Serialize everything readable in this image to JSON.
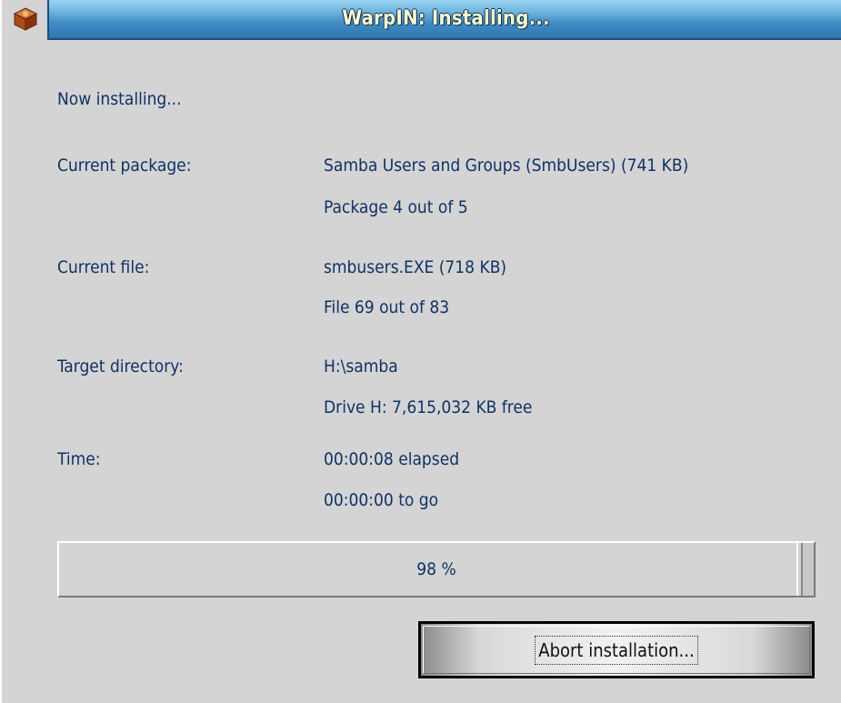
{
  "window": {
    "title": "WarpIN: Installing...",
    "icon": "package-box-icon"
  },
  "status": {
    "heading": "Now installing..."
  },
  "rows": {
    "package": {
      "label": "Current package:",
      "value": "Samba Users and Groups (SmbUsers) (741 KB)",
      "detail": "Package 4 out of 5"
    },
    "file": {
      "label": "Current file:",
      "value": "smbusers.EXE (718 KB)",
      "detail": "File 69 out of 83"
    },
    "target": {
      "label": "Target directory:",
      "value": "H:\\samba",
      "detail": "Drive H: 7,615,032 KB free"
    },
    "time": {
      "label": "Time:",
      "value": "00:00:08 elapsed",
      "detail": "00:00:00 to go"
    }
  },
  "progress": {
    "percent": 98,
    "label": "98 %"
  },
  "buttons": {
    "abort_label": "Abort installation..."
  }
}
